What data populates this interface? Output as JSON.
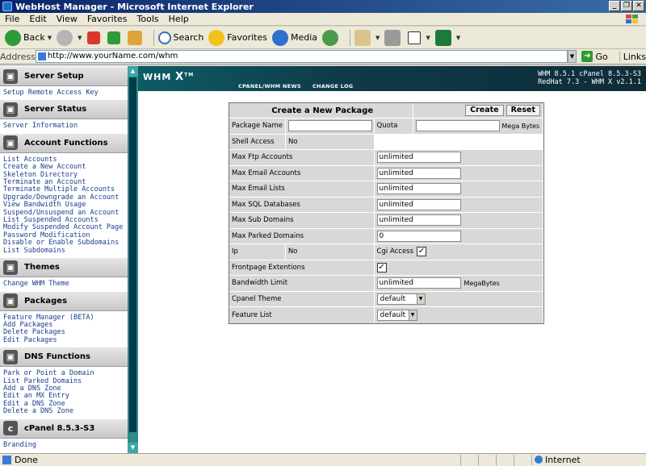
{
  "window": {
    "title": "WebHost Manager - Microsoft Internet Explorer"
  },
  "menubar": [
    "File",
    "Edit",
    "View",
    "Favorites",
    "Tools",
    "Help"
  ],
  "toolbar": {
    "back": "Back",
    "search": "Search",
    "favorites": "Favorites",
    "media": "Media"
  },
  "address": {
    "label": "Address",
    "url": "http://www.yourName.com/whm",
    "go": "Go",
    "links": "Links"
  },
  "sidebar": {
    "sections": [
      {
        "title": "Server Setup",
        "links": [
          "Setup Remote Access Key"
        ]
      },
      {
        "title": "Server Status",
        "links": [
          "Server Information"
        ]
      },
      {
        "title": "Account Functions",
        "links": [
          "List Accounts",
          "Create a New Account",
          "Skeleton Directory",
          "Terminate an Account",
          "Terminate Multiple Accounts",
          "Upgrade/Downgrade an Account",
          "View Bandwidth Usage",
          "Suspend/Unsuspend an Account",
          "List Suspended Accounts",
          "Modify Suspended Account Page",
          "Password Modification",
          "Disable or Enable Subdomains",
          "List Subdomains"
        ]
      },
      {
        "title": "Themes",
        "links": [
          "Change WHM Theme"
        ]
      },
      {
        "title": "Packages",
        "links": [
          "Feature Manager (BETA)",
          "Add Packages",
          "Delete Packages",
          "Edit Packages"
        ]
      },
      {
        "title": "DNS Functions",
        "links": [
          "Park or Point a Domain",
          "List Parked Domains",
          "Add a DNS Zone",
          "Edit an MX Entry",
          "Edit a DNS Zone",
          "Delete a DNS Zone"
        ]
      },
      {
        "title": "cPanel 8.5.3-S3",
        "links": [
          "Branding"
        ]
      }
    ]
  },
  "header": {
    "logo": "WHM",
    "logo_x": "X",
    "logo_tm": "TM",
    "nav": [
      "CPANEL/WHM NEWS",
      "CHANGE LOG"
    ],
    "version_line1": "WHM 8.5.1 cPanel 8.5.3-S3",
    "version_line2": "RedHat 7.3 - WHM X v2.1.1"
  },
  "form": {
    "title": "Create a New Package",
    "create": "Create",
    "reset": "Reset",
    "package_name_label": "Package Name",
    "package_name_value": "",
    "quota_label": "Quota",
    "quota_value": "",
    "quota_unit": "Mega Bytes",
    "shell_label": "Shell Access",
    "shell_value": "No",
    "rows": [
      {
        "label": "Max Ftp Accounts",
        "value": "unlimited"
      },
      {
        "label": "Max Email Accounts",
        "value": "unlimited"
      },
      {
        "label": "Max Email Lists",
        "value": "unlimited"
      },
      {
        "label": "Max SQL Databases",
        "value": "unlimited"
      },
      {
        "label": "Max Sub Domains",
        "value": "unlimited"
      },
      {
        "label": "Max Parked Domains",
        "value": "0"
      }
    ],
    "ip_label": "Ip",
    "ip_value": "No",
    "cgi_label": "Cgi Access",
    "frontpage_label": "Frontpage Extentions",
    "bandwidth_label": "Bandwidth Limit",
    "bandwidth_value": "unlimited",
    "bandwidth_unit": "MegaBytes",
    "theme_label": "Cpanel Theme",
    "theme_value": "default",
    "feature_label": "Feature List",
    "feature_value": "default"
  },
  "status": {
    "text": "Done",
    "zone": "Internet"
  }
}
